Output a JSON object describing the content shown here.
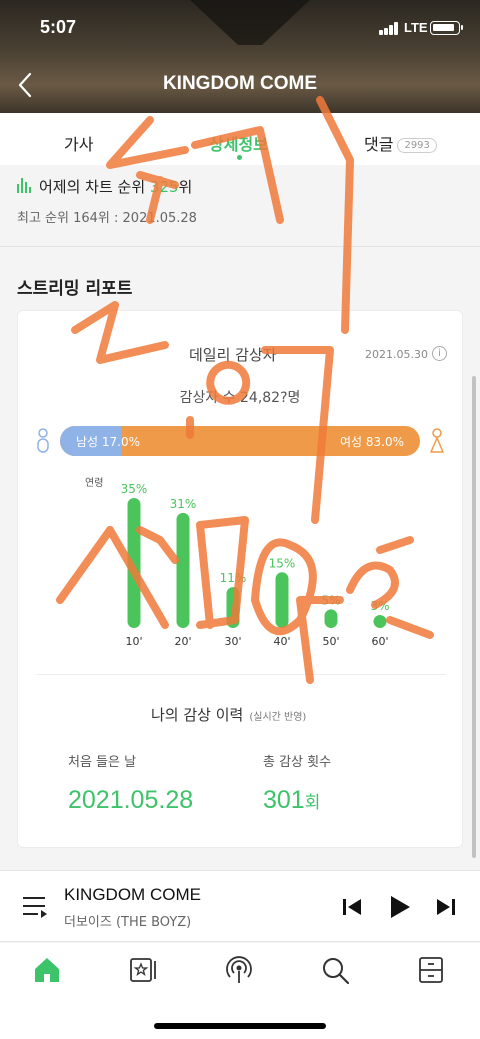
{
  "status_bar": {
    "time": "5:07",
    "network": "LTE"
  },
  "header": {
    "title": "KINGDOM COME"
  },
  "tabs": {
    "lyrics": "가사",
    "detail": "상세정보",
    "comments": "댓글",
    "comments_count": "2993"
  },
  "chart_info": {
    "yesterday_prefix": "어제의 차트 순위 ",
    "yesterday_rank": "325",
    "yesterday_suffix": "위",
    "best": "최고 순위 164위 : 2021.05.28"
  },
  "streaming_report": {
    "title": "스트리밍 리포트",
    "daily_title": "데일리 감상자",
    "date": "2021.05.30",
    "listeners": "감상자 수 24,82?명",
    "male_label": "남성 17.0%",
    "female_label": "여성 83.0%",
    "male_ratio": 0.17,
    "age_axis_label": "연령",
    "my_history_title": "나의 감상 이력",
    "my_history_sub": "(실시간 반영)",
    "first_listen_label": "처음 들은 날",
    "first_listen_date": "2021.05.28",
    "total_count_label": "총 감상 횟수",
    "total_count": "301",
    "total_count_unit": "회"
  },
  "chart_data": {
    "type": "bar",
    "categories": [
      "10'",
      "20'",
      "30'",
      "40'",
      "50'",
      "60'"
    ],
    "values": [
      35,
      31,
      11,
      15,
      5,
      3
    ],
    "value_labels": [
      "35%",
      "31%",
      "11%",
      "15%",
      "5%",
      "3%"
    ],
    "xlabel": "연령",
    "ylabel": "",
    "ylim": [
      0,
      35
    ],
    "color": "#4cc45c"
  },
  "player": {
    "song": "KINGDOM COME",
    "artist": "더보이즈 (THE BOYZ)"
  },
  "icons": {
    "back": "chevron-left-icon",
    "queue": "playlist-icon",
    "prev": "skip-back-icon",
    "play": "play-icon",
    "next": "skip-forward-icon",
    "home": "home-icon",
    "library": "library-icon",
    "station": "radio-icon",
    "search": "search-icon",
    "storage": "drawer-icon"
  },
  "colors": {
    "accent": "#3dc36a",
    "male": "#8fb3e6",
    "female": "#ef9a48",
    "scribble": "#f07a3a"
  }
}
